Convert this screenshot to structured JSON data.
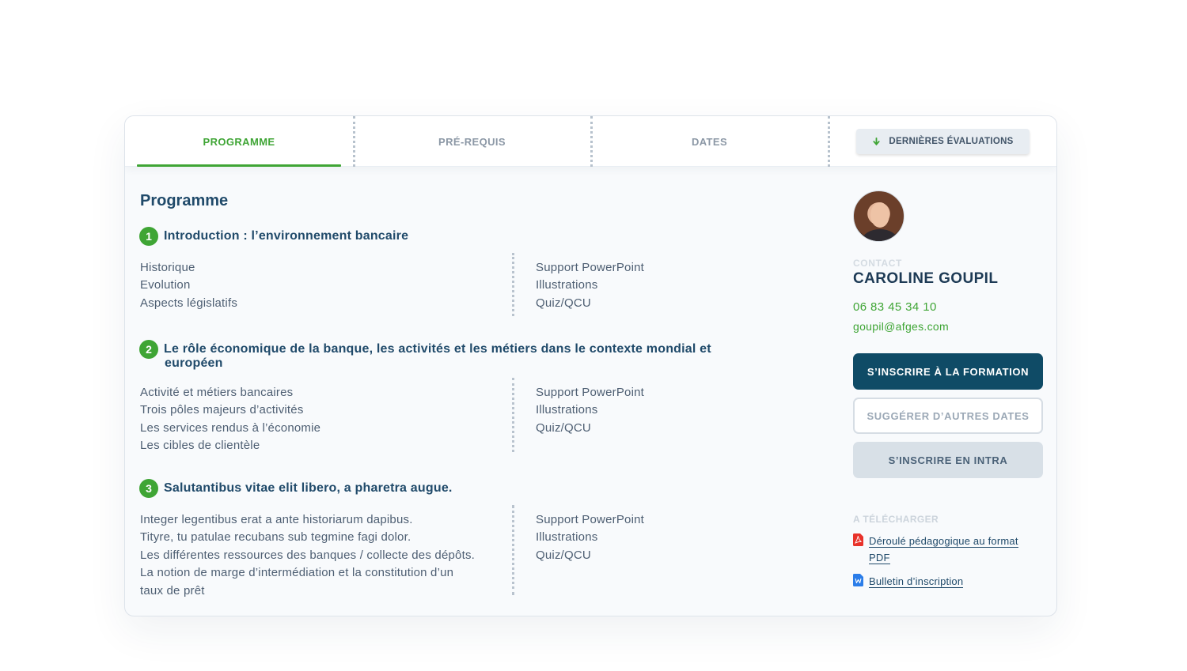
{
  "tabs": [
    {
      "label": "PROGRAMME",
      "active": true
    },
    {
      "label": "PRÉ-REQUIS",
      "active": false
    },
    {
      "label": "DATES",
      "active": false
    }
  ],
  "eval_button": {
    "label": "DERNIÈRES ÉVALUATIONS",
    "icon": "arrow-down-icon"
  },
  "page_title": "Programme",
  "sections": [
    {
      "number": "1",
      "title": "Introduction : l’environnement bancaire",
      "left": [
        "Historique",
        "Evolution",
        "Aspects législatifs"
      ],
      "right": [
        "Support PowerPoint",
        "Illustrations",
        "Quiz/QCU"
      ]
    },
    {
      "number": "2",
      "title_line1": "Le rôle économique de la banque, les activités et les métiers dans le contexte mondial et",
      "title_line2": "européen",
      "left": [
        "Activité et métiers bancaires",
        "Trois pôles majeurs d’activités",
        "Les services rendus à l’économie",
        "Les cibles de  clientèle"
      ],
      "right": [
        "Support PowerPoint",
        "Illustrations",
        "Quiz/QCU"
      ]
    },
    {
      "number": "3",
      "title": "Salutantibus vitae elit libero, a pharetra augue.",
      "left": [
        "Integer legentibus erat a ante historiarum dapibus.",
        "Tityre, tu patulae recubans sub tegmine fagi  dolor.",
        "Les différentes ressources des banques / collecte des dépôts.",
        "La notion de marge d’intermédiation et la constitution d’un",
        "taux de prêt"
      ],
      "right": [
        "Support PowerPoint",
        "Illustrations",
        "Quiz/QCU"
      ]
    }
  ],
  "contact": {
    "label": "CONTACT",
    "name": "CAROLINE GOUPIL",
    "phone": "06 83 45 34 10",
    "email": "goupil@afges.com"
  },
  "actions": {
    "register": "S’INSCRIRE À LA FORMATION",
    "suggest": "SUGGÉRER D’AUTRES DATES",
    "intra": "S’INSCRIRE EN INTRA"
  },
  "downloads": {
    "label": "A TÉLÉCHARGER",
    "items": [
      {
        "line1": "Déroulé pédagogique au format",
        "line2": "PDF",
        "icon": "pdf-file-icon"
      },
      {
        "line1": "Bulletin d’inscription",
        "icon": "word-file-icon"
      }
    ]
  },
  "colors": {
    "accent": "#3fa535",
    "primary": "#0f4b66",
    "title": "#204a6a"
  }
}
